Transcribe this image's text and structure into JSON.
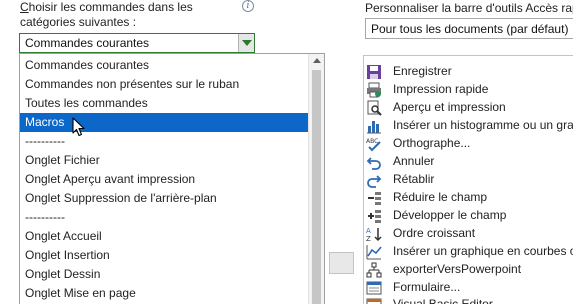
{
  "left": {
    "label_line1": "hoisir les commandes dans les",
    "label_first_letter": "C",
    "label_line2": "catégories suivantes :",
    "info_icon": "info-icon",
    "combo_value": "Commandes courantes",
    "dropdown_items": [
      {
        "label": "Commandes courantes",
        "selected": false
      },
      {
        "label": "Commandes non présentes sur le ruban",
        "selected": false
      },
      {
        "label": "Toutes les commandes",
        "selected": false
      },
      {
        "label": "Macros",
        "selected": true
      },
      {
        "label": "----------",
        "selected": false
      },
      {
        "label": "Onglet Fichier",
        "selected": false
      },
      {
        "label": "Onglet Aperçu avant impression",
        "selected": false
      },
      {
        "label": "Onglet Suppression de l'arrière-plan",
        "selected": false
      },
      {
        "label": "----------",
        "selected": false
      },
      {
        "label": "Onglet Accueil",
        "selected": false
      },
      {
        "label": "Onglet Insertion",
        "selected": false
      },
      {
        "label": "Onglet Dessin",
        "selected": false
      },
      {
        "label": "Onglet Mise en page",
        "selected": false
      }
    ]
  },
  "right": {
    "label": "Personnaliser la barre d'outils Accès rapi",
    "combo_value": "Pour tous les documents (par défaut)",
    "items": [
      {
        "label": "Enregistrer",
        "icon": "save-icon"
      },
      {
        "label": "Impression rapide",
        "icon": "quick-print-icon"
      },
      {
        "label": "Aperçu et impression",
        "icon": "print-preview-icon"
      },
      {
        "label": "Insérer un histogramme ou un gra...",
        "icon": "histogram-icon"
      },
      {
        "label": "Orthographe...",
        "icon": "spelling-icon"
      },
      {
        "label": "Annuler",
        "icon": "undo-icon"
      },
      {
        "label": "Rétablir",
        "icon": "redo-icon"
      },
      {
        "label": "Réduire le champ",
        "icon": "collapse-field-icon"
      },
      {
        "label": "Développer le champ",
        "icon": "expand-field-icon"
      },
      {
        "label": "Ordre croissant",
        "icon": "sort-ascending-icon"
      },
      {
        "label": "Insérer un graphique en courbes o...",
        "icon": "line-chart-icon"
      },
      {
        "label": "exporterVersPowerpoint",
        "icon": "macro-icon"
      },
      {
        "label": "Formulaire...",
        "icon": "form-icon"
      },
      {
        "label": "Visual Basic Editor",
        "icon": "vbe-icon"
      }
    ]
  },
  "colors": {
    "selection": "#0c67c9",
    "combo_border": "#2f7d32"
  }
}
